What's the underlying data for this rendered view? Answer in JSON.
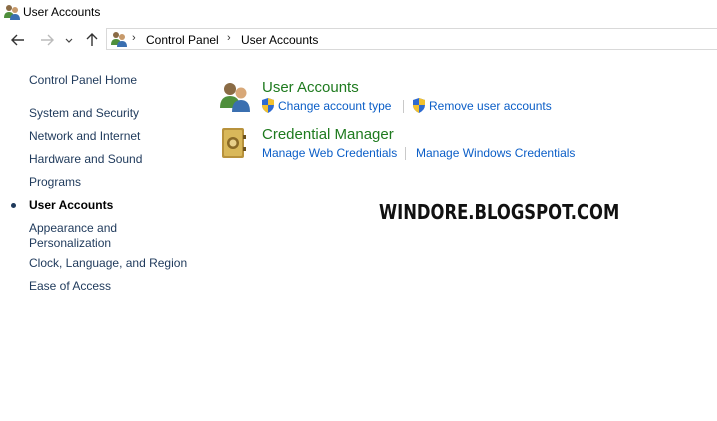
{
  "window": {
    "title": "User Accounts"
  },
  "navigation": {
    "back_icon": "arrow-left-icon",
    "forward_icon": "arrow-right-icon",
    "recent_icon": "chevron-down-icon",
    "up_icon": "arrow-up-icon"
  },
  "address": {
    "breadcrumbs": [
      "Control Panel",
      "User Accounts"
    ]
  },
  "sidebar": {
    "home": "Control Panel Home",
    "items": [
      "System and Security",
      "Network and Internet",
      "Hardware and Sound",
      "Programs",
      "User Accounts",
      "Appearance and Personalization",
      "Clock, Language, and Region",
      "Ease of Access"
    ],
    "appearance_line1": "Appearance and",
    "appearance_line2": "Personalization",
    "current": "User Accounts"
  },
  "sections": [
    {
      "title": "User Accounts",
      "icon": "users-icon",
      "tasks": [
        "Change account type",
        "Remove user accounts"
      ]
    },
    {
      "title": "Credential Manager",
      "icon": "vault-icon",
      "tasks": [
        "Manage Web Credentials",
        "Manage Windows Credentials"
      ]
    }
  ],
  "watermark": "WINDORE.BLOGSPOT.COM",
  "colors": {
    "section_title": "#1e7a1e",
    "task_link": "#0b5ec7",
    "sidebar_link": "#1e395b"
  }
}
